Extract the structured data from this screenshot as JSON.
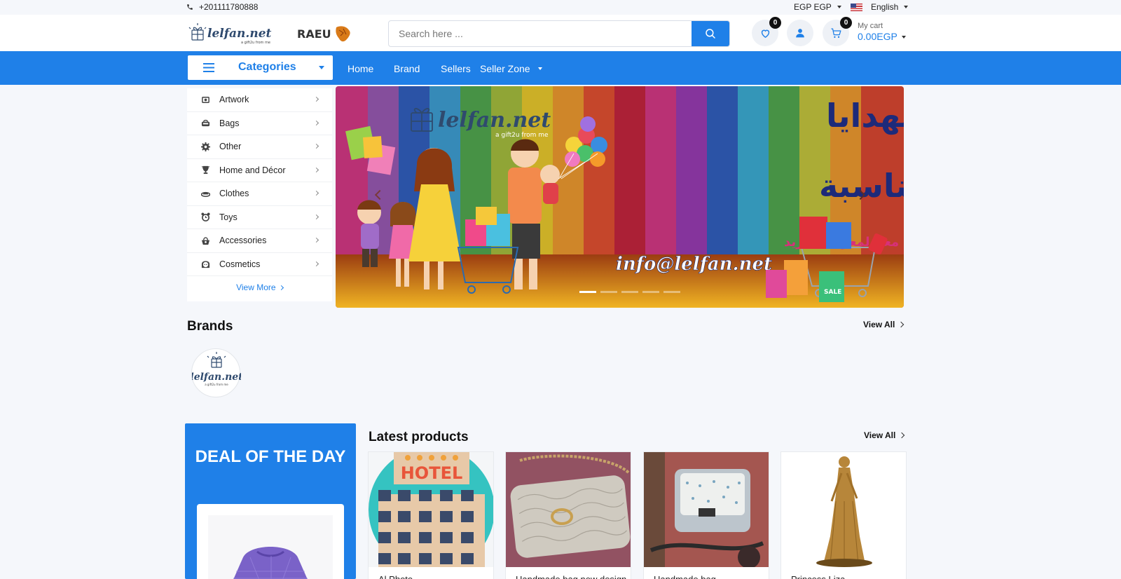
{
  "topbar": {
    "phone": "+201111780888",
    "currency": "EGP EGP",
    "language": "English"
  },
  "header": {
    "logo_primary_text": "lelfan.net",
    "logo_primary_tagline": "a gift2u from me",
    "logo_secondary_text": "RAEU",
    "search_placeholder": "Search here ...",
    "wishlist_count": "0",
    "cart_count": "0",
    "cart_label": "My cart",
    "cart_amount": "0.00EGP"
  },
  "nav": {
    "categories_label": "Categories",
    "links": [
      "Home",
      "Brand",
      "Sellers",
      "Seller Zone"
    ]
  },
  "categories": {
    "items": [
      {
        "label": "Artwork",
        "icon": "artwork-icon"
      },
      {
        "label": "Bags",
        "icon": "bag-icon"
      },
      {
        "label": "Other",
        "icon": "gear-icon"
      },
      {
        "label": "Home and Décor",
        "icon": "trophy-icon"
      },
      {
        "label": "Clothes",
        "icon": "hat-icon"
      },
      {
        "label": "Toys",
        "icon": "alarm-icon"
      },
      {
        "label": "Accessories",
        "icon": "basket-icon"
      },
      {
        "label": "Cosmetics",
        "icon": "face-icon"
      }
    ],
    "view_more": "View More"
  },
  "banner": {
    "logo_text": "lelfan.net",
    "logo_tagline": "a gift2u from me",
    "headline_line1": "كل انواع الهدايا",
    "headline_line2": "لكل مناسبة",
    "subline": "تواصل معنا لمعرفة المزيد",
    "email": "info@lelfan.net",
    "sale_tag": "SALE",
    "slides": 5,
    "active_slide": 1
  },
  "brands": {
    "title": "Brands",
    "view_all": "View All",
    "logo_text": "lelfan.net",
    "logo_tagline": "a gift2u from me"
  },
  "deal": {
    "title": "DEAL OF THE DAY"
  },
  "latest": {
    "title": "Latest products",
    "view_all": "View All",
    "products": [
      {
        "name": "Al Photo",
        "sign_text": "HOTEL"
      },
      {
        "name": "Handmade bag new design"
      },
      {
        "name": "Handmade bag"
      },
      {
        "name": "Princess Liza"
      }
    ]
  },
  "colors": {
    "accent": "#1f80e8",
    "page_bg": "#f5f7fb",
    "badge": "#111111"
  }
}
